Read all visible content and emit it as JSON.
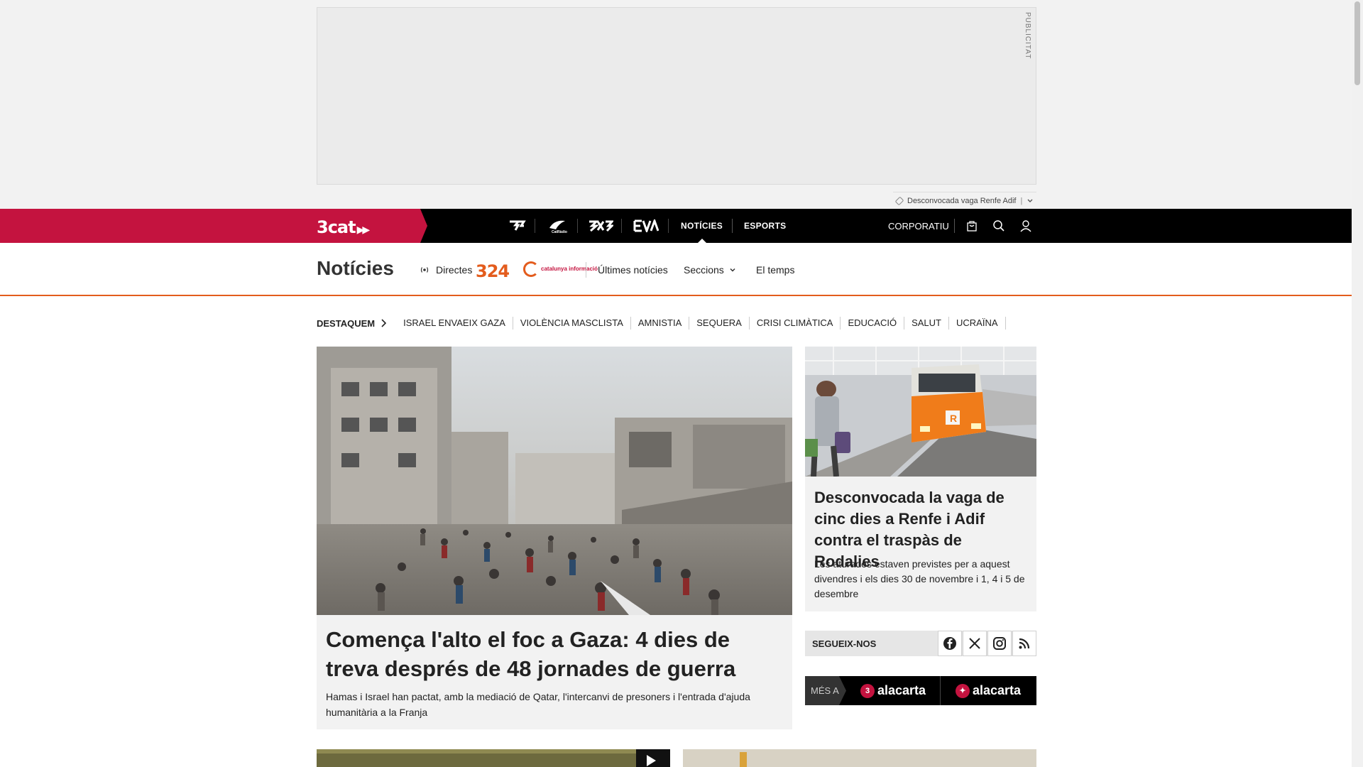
{
  "ad": {
    "label": "PUBLICITAT"
  },
  "ticker": {
    "text": "Desconvocada vaga Renfe Adif"
  },
  "top_nav": {
    "brand": "3cat",
    "channels": [
      {
        "label": "3",
        "icon": "tv3-logo-icon"
      },
      {
        "label": "Cat Ràdio",
        "icon": "catradio-logo-icon"
      },
      {
        "label": "SX3",
        "icon": "sx3-logo-icon"
      },
      {
        "label": "EVA",
        "icon": "eva-logo-icon"
      }
    ],
    "links": [
      {
        "label": "NOTÍCIES",
        "active": true
      },
      {
        "label": "ESPORTS",
        "active": false
      }
    ],
    "corporate": "CORPORATIU",
    "icons": [
      "shopping-bag-icon",
      "search-icon",
      "user-icon"
    ]
  },
  "sub_nav": {
    "title": "Notícies",
    "live": "Directes",
    "logo_324": "324",
    "logo_ci": "catalunya informació",
    "items": [
      "Últimes notícies",
      "Seccions",
      "El temps"
    ]
  },
  "tags": {
    "lead": "DESTAQUEM",
    "items": [
      "ISRAEL ENVAEIX GAZA",
      "VIOLÈNCIA MASCLISTA",
      "AMNISTIA",
      "SEQUERA",
      "CRISI CLIMÀTICA",
      "EDUCACIÓ",
      "SALUT",
      "UCRAÏNA"
    ]
  },
  "hero": {
    "title": "Comença l'alto el foc a Gaza: 4 dies de treva després de 48 jornades de guerra",
    "summary": "Hamas i Israel han pactat, amb la mediació de Qatar, l'intercanvi de presoners i l'entrada d'ajuda humanitària a la Franja"
  },
  "side_story": {
    "title": "Desconvocada la vaga de cinc dies a Renfe i Adif contra el traspàs de Rodalies",
    "summary": "Les aturades estaven previstes per a aquest divendres i els dies 30 de novembre i 1, 4 i 5 de desembre"
  },
  "follow": {
    "label": "SEGUEIX-NOS",
    "networks": [
      "facebook-icon",
      "x-twitter-icon",
      "instagram-icon",
      "rss-icon"
    ]
  },
  "alacarta": {
    "lead": "MÉS A",
    "logos": [
      "alacarta",
      "alacarta"
    ]
  },
  "colors": {
    "brand_red": "#c4133f",
    "accent_orange": "#e35c1d",
    "nav_black": "#000000"
  }
}
